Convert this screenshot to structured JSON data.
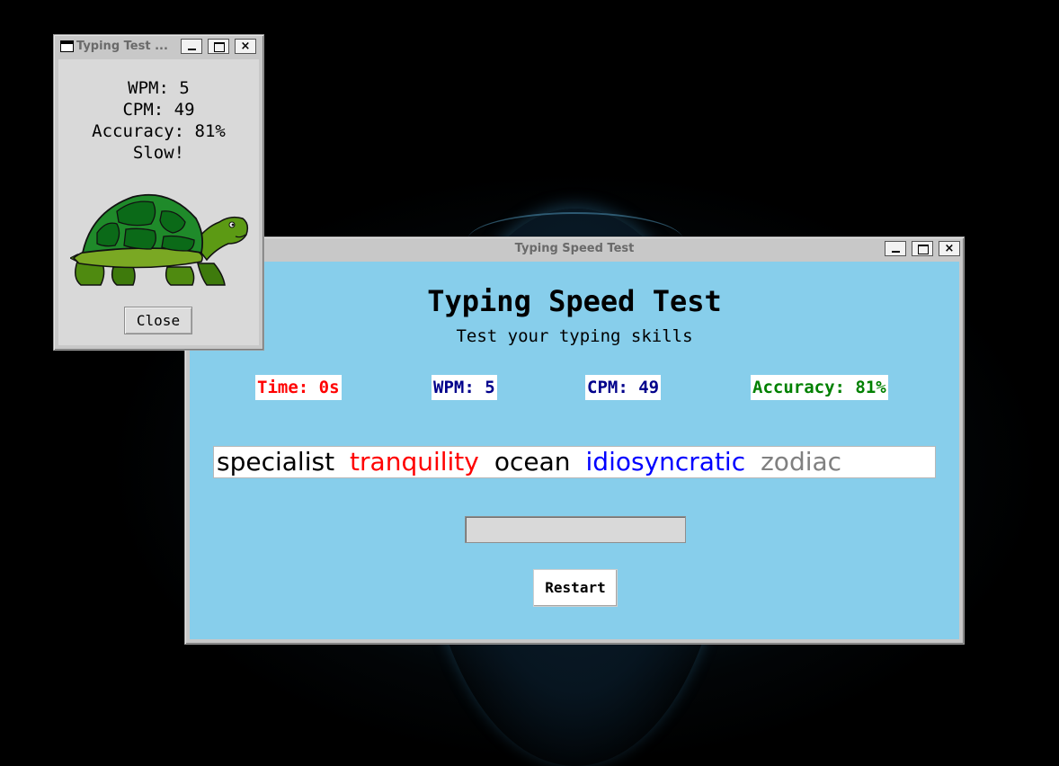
{
  "main_window": {
    "title": "Typing Speed Test",
    "heading": "Typing Speed Test",
    "subtitle": "Test your typing skills",
    "stats": {
      "time": "Time: 0s",
      "wpm": "WPM: 5",
      "cpm": "CPM: 49",
      "accuracy": "Accuracy: 81%"
    },
    "stat_colors": {
      "time": "#ff0000",
      "wpm": "#00008b",
      "cpm": "#00008b",
      "accuracy": "#008000"
    },
    "words": [
      {
        "text": "specialist",
        "color": "#000000"
      },
      {
        "text": "tranquility",
        "color": "#ff0000"
      },
      {
        "text": "ocean",
        "color": "#000000"
      },
      {
        "text": "idiosyncratic",
        "color": "#0000ff"
      },
      {
        "text": "zodiac",
        "color": "#808080"
      }
    ],
    "input_value": "",
    "restart_label": "Restart",
    "background_color": "#87ceeb"
  },
  "popup_window": {
    "title": "Typing Test ...",
    "wpm": "WPM: 5",
    "cpm": "CPM: 49",
    "accuracy": "Accuracy: 81%",
    "verdict": "Slow!",
    "image": "turtle-image",
    "close_label": "Close"
  },
  "window_controls": {
    "minimize": "minimize-icon",
    "maximize": "maximize-icon",
    "close": "×"
  }
}
